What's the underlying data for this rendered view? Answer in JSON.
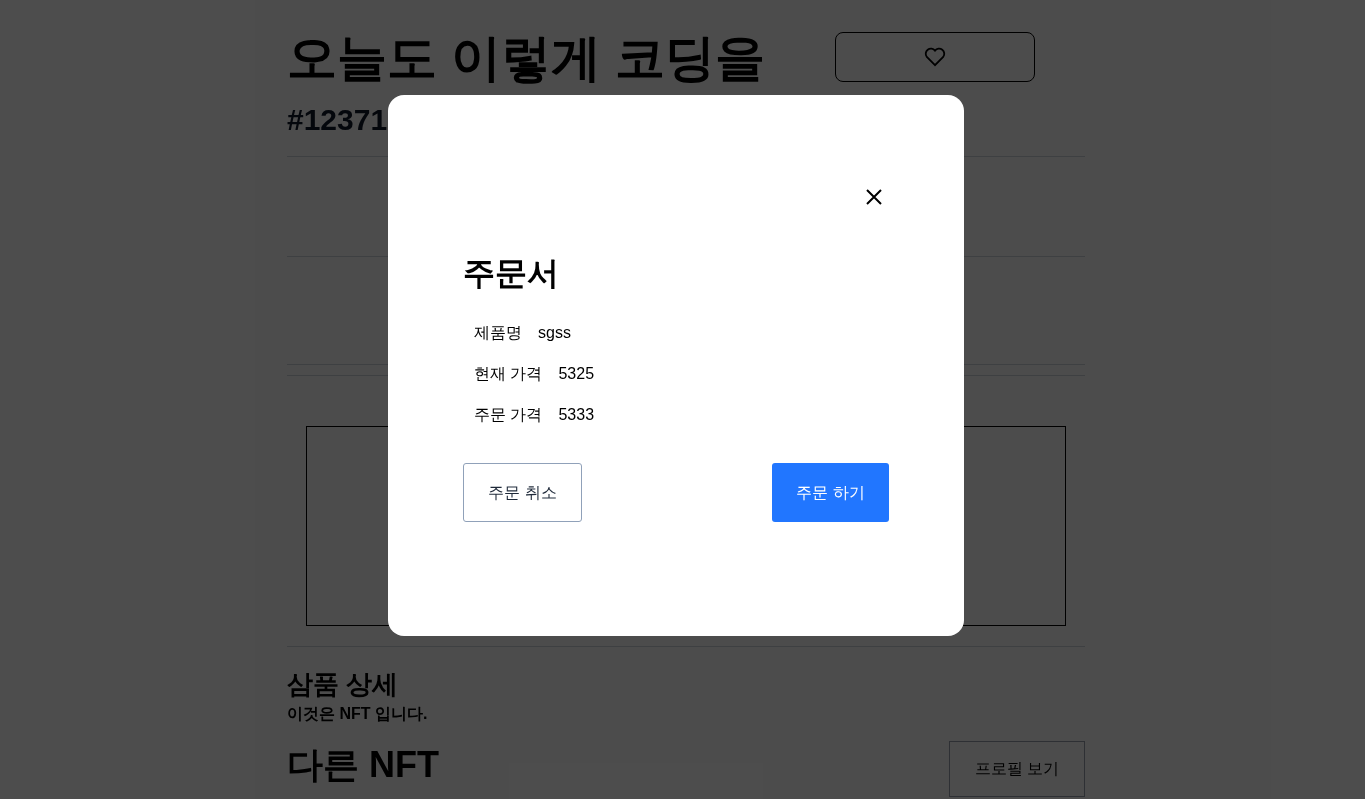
{
  "page": {
    "title": "오늘도 이렇게 코딩을",
    "token_id": "#12371",
    "detail_heading": "삼품 상세",
    "detail_text": "이것은 NFT 입니다.",
    "other_heading": "다른 NFT",
    "profile_button": "프로필 보기"
  },
  "modal": {
    "title": "주문서",
    "fields": [
      {
        "label": "제품명",
        "value": "sgss"
      },
      {
        "label": "현재 가격",
        "value": "5325"
      },
      {
        "label": "주문 가격",
        "value": "5333"
      }
    ],
    "cancel_button": "주문 취소",
    "submit_button": "주문 하기"
  }
}
